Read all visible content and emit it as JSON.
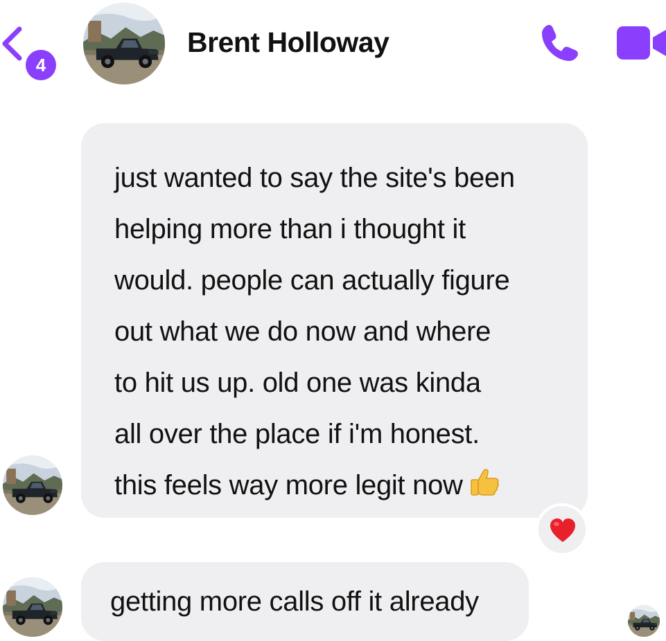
{
  "header": {
    "back_icon": "chevron-left-icon",
    "unread_count": "4",
    "contact_name": "Brent Holloway",
    "call_icon": "phone-icon",
    "video_icon": "video-camera-icon"
  },
  "messages": [
    {
      "sender": "contact",
      "lines": [
        "just wanted to say the site's been",
        "helping more than i thought it",
        "would. people can actually figure",
        "out what we do now and where",
        "to hit us up. old one was kinda",
        "all over the place if i'm honest.",
        "this feels way more legit now"
      ],
      "trailing_emoji": "thumbs-up-icon",
      "reaction": "red-heart-icon"
    },
    {
      "sender": "contact",
      "text": "getting more calls off it already"
    }
  ],
  "colors": {
    "accent": "#8a3ffc",
    "bubble": "#efeff1",
    "heart": "#e8202c"
  }
}
